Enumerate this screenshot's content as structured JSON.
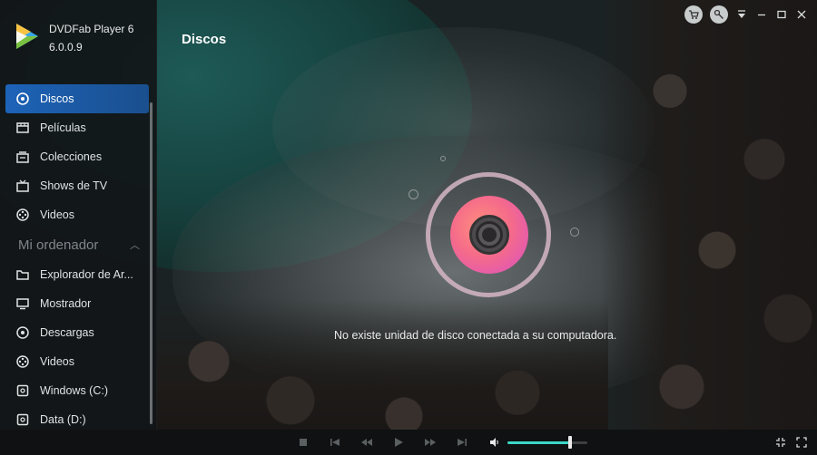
{
  "app": {
    "name": "DVDFab Player 6",
    "version": "6.0.0.9"
  },
  "sidebar": {
    "library_items": [
      {
        "label": "Discos",
        "icon": "disc-icon",
        "active": true
      },
      {
        "label": "Películas",
        "icon": "film-icon",
        "active": false
      },
      {
        "label": "Colecciones",
        "icon": "collection-icon",
        "active": false
      },
      {
        "label": "Shows de TV",
        "icon": "tv-icon",
        "active": false
      },
      {
        "label": "Videos",
        "icon": "video-reel-icon",
        "active": false
      }
    ],
    "section_title": "Mi ordenador",
    "computer_items": [
      {
        "label": "Explorador de Ar...",
        "icon": "folder-icon"
      },
      {
        "label": "Mostrador",
        "icon": "monitor-icon"
      },
      {
        "label": "Descargas",
        "icon": "download-icon"
      },
      {
        "label": "Videos",
        "icon": "video-reel-icon"
      },
      {
        "label": "Windows (C:)",
        "icon": "drive-icon"
      },
      {
        "label": "Data (D:)",
        "icon": "drive-icon"
      }
    ]
  },
  "main": {
    "title": "Discos",
    "empty_message": "No existe unidad de disco conectada a su computadora."
  },
  "player": {
    "volume": 0.78
  },
  "colors": {
    "accent": "#1d63b8",
    "volume": "#3bd8c6",
    "disc_start": "#ff8f7c",
    "disc_end": "#d84fc4"
  }
}
